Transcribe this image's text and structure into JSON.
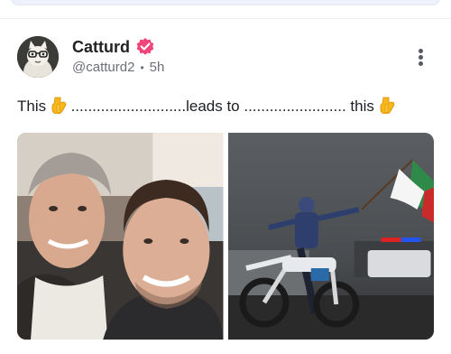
{
  "post": {
    "author_name": "Catturd",
    "handle": "@catturd2",
    "separator": "•",
    "time_ago": "5h",
    "text_part1": "This ",
    "text_part2": " ...........................leads to ........................ this ",
    "emoji_icon": "point-down-emoji",
    "verified_icon": "verified-badge-icon",
    "menu_icon": "more-vertical-icon"
  },
  "media": [
    {
      "icon": "photo-selfie-two-men"
    },
    {
      "icon": "photo-motorcycle-flag-protest"
    }
  ],
  "colors": {
    "verified": "#f0447b",
    "text": "#1c1f23",
    "muted": "#6b6f76"
  }
}
